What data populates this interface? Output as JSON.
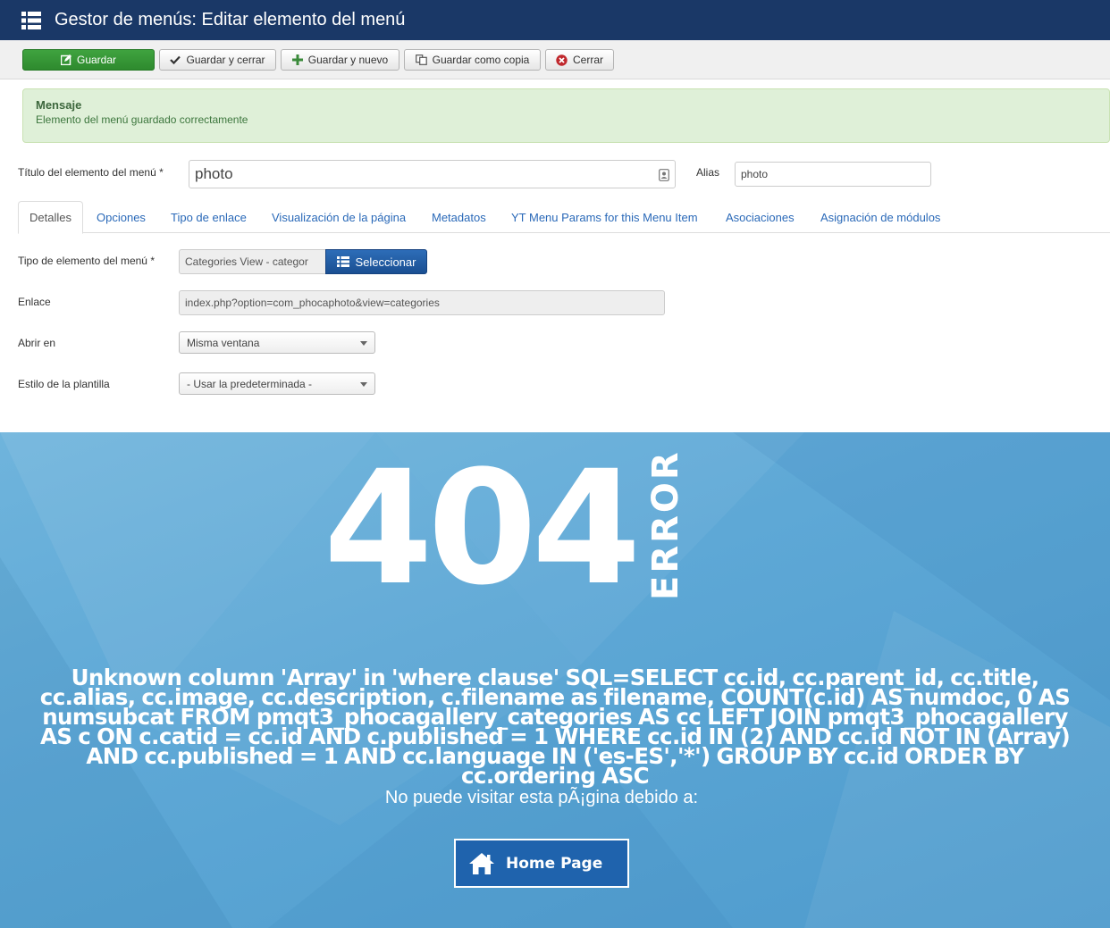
{
  "header": {
    "title": "Gestor de menús: Editar elemento del menú",
    "icon": "list-icon",
    "bg_color": "#1a3867"
  },
  "toolbar": {
    "save": "Guardar",
    "save_close": "Guardar y cerrar",
    "save_new": "Guardar y nuevo",
    "save_copy": "Guardar como copia",
    "close": "Cerrar"
  },
  "alert": {
    "heading": "Mensaje",
    "message": "Elemento del menú guardado correctamente"
  },
  "form": {
    "title_label": "Título del elemento del menú *",
    "title_value": "photo",
    "alias_label": "Alias",
    "alias_value": "photo"
  },
  "tabs": [
    {
      "label": "Detalles",
      "active": true
    },
    {
      "label": "Opciones"
    },
    {
      "label": "Tipo de enlace"
    },
    {
      "label": "Visualización de la página"
    },
    {
      "label": "Metadatos"
    },
    {
      "label": "YT Menu Params for this Menu Item"
    },
    {
      "label": "Asociaciones"
    },
    {
      "label": "Asignación de módulos"
    }
  ],
  "details": {
    "type_label": "Tipo de elemento del menú *",
    "type_value": "Categories View - categor",
    "select_button": "Seleccionar",
    "link_label": "Enlace",
    "link_value": "index.php?option=com_phocaphoto&view=categories",
    "open_label": "Abrir en",
    "open_value": "Misma ventana",
    "template_label": "Estilo de la plantilla",
    "template_value": "- Usar la predeterminada -"
  },
  "error_page": {
    "code": "404",
    "word": "ERROR",
    "sql_message": "Unknown column 'Array' in 'where clause' SQL=SELECT cc.id, cc.parent_id, cc.title, cc.alias, cc.image, cc.description, c.filename as filename, COUNT(c.id) AS numdoc, 0 AS numsubcat FROM pmqt3_phocagallery_categories AS cc LEFT JOIN pmqt3_phocagallery AS c ON c.catid = cc.id AND c.published = 1 WHERE cc.id IN (2) AND cc.id NOT IN (Array) AND cc.published = 1 AND cc.language IN ('es-ES','*') GROUP BY cc.id ORDER BY cc.ordering ASC",
    "cannot_visit": "No puede visitar esta pÃ¡gina debido a:",
    "home_button": "Home Page"
  }
}
